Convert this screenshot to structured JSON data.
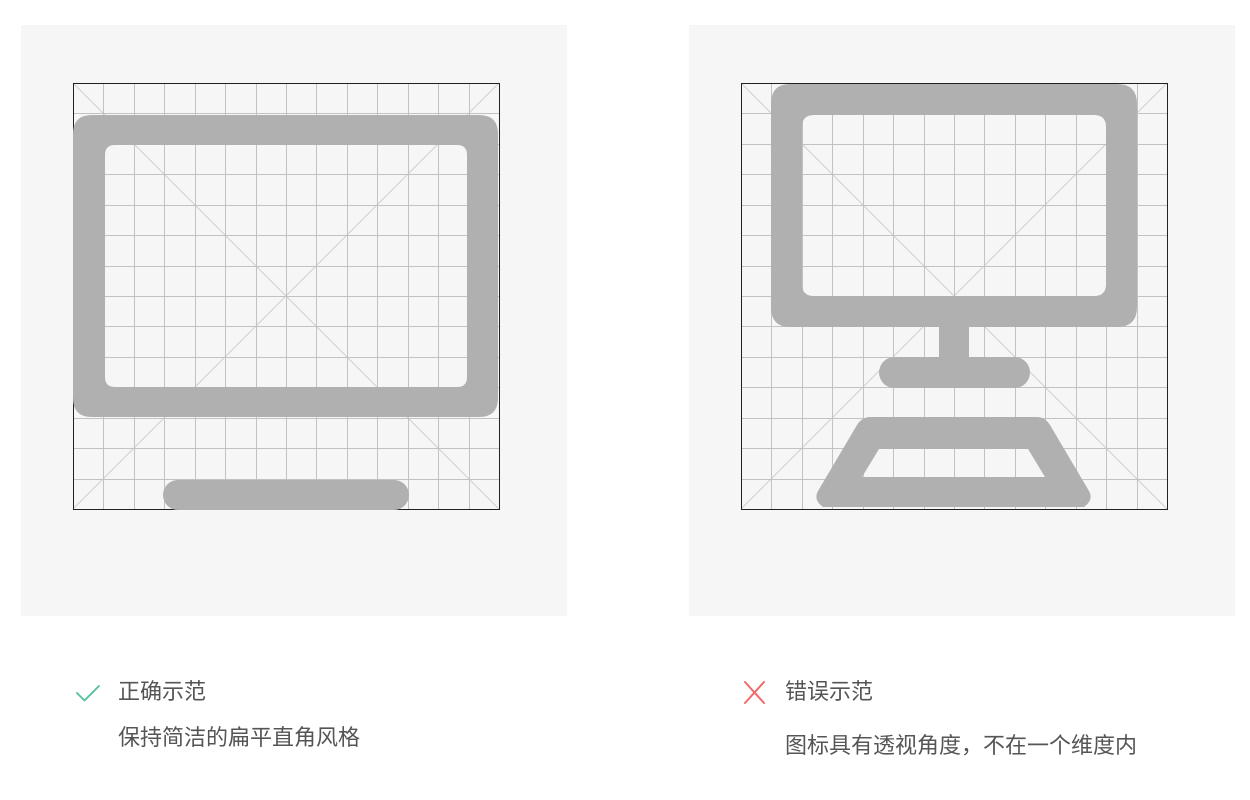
{
  "colors": {
    "panel_bg": "#f6f6f6",
    "grid_line": "#c2c2c2",
    "grid_border": "#222222",
    "diagonal": "#d0d0d0",
    "icon_fill": "#b0b0b0",
    "good_mark": "#4fbf9f",
    "bad_mark": "#f06a6a",
    "text": "#555555"
  },
  "good": {
    "icon_name": "monitor-flat-icon",
    "mark_icon": "check-icon",
    "title": "正确示范",
    "description": "保持简洁的扁平直角风格"
  },
  "bad": {
    "icon_name": "monitor-perspective-icon",
    "mark_icon": "cross-icon",
    "title": "错误示范",
    "description": "图标具有透视角度，不在一个维度内"
  }
}
